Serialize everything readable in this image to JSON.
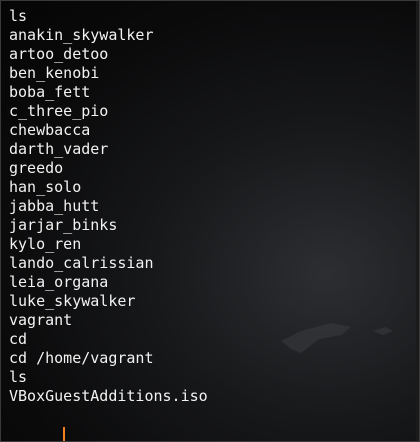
{
  "terminal": {
    "lines": [
      "ls",
      "anakin_skywalker",
      "artoo_detoo",
      "ben_kenobi",
      "boba_fett",
      "c_three_pio",
      "chewbacca",
      "darth_vader",
      "greedo",
      "han_solo",
      "jabba_hutt",
      "jarjar_binks",
      "kylo_ren",
      "lando_calrissian",
      "leia_organa",
      "luke_skywalker",
      "vagrant",
      "cd",
      "cd /home/vagrant",
      "ls",
      "VBoxGuestAdditions.iso"
    ],
    "cursor_color": "#f08020",
    "text_color": "#f2f2f2",
    "background_color": "#0b0b0c"
  }
}
